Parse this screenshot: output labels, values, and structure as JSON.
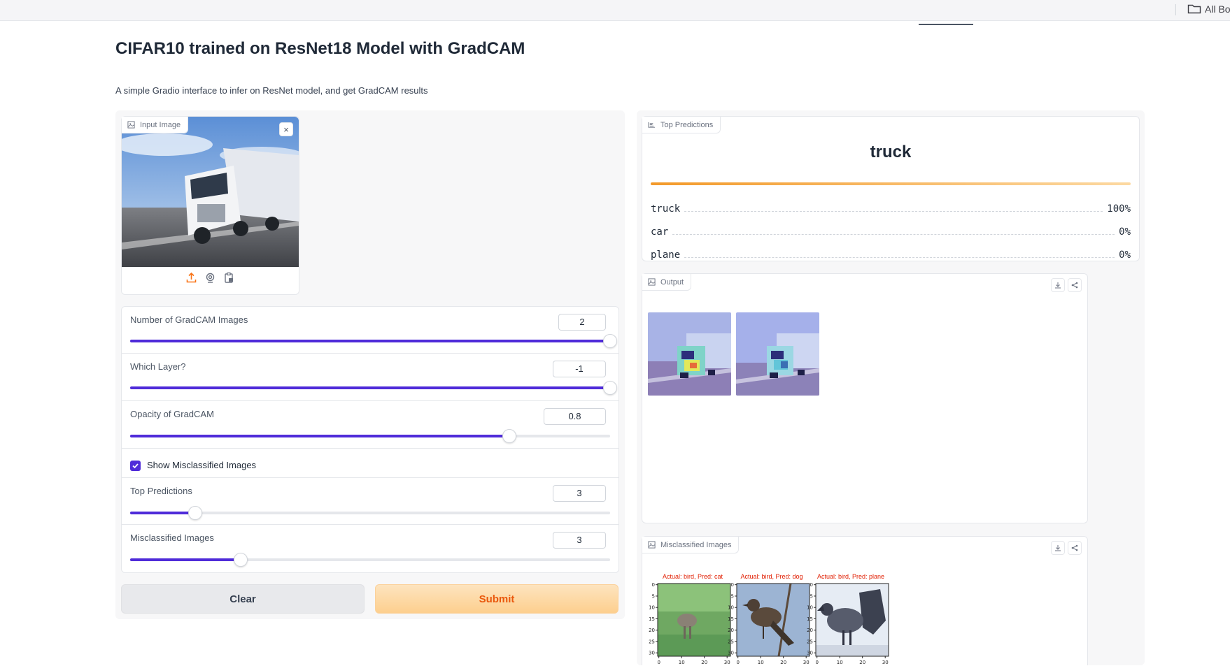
{
  "browser": {
    "bookmark_label": "All Bo"
  },
  "header": {
    "title": "CIFAR10 trained on ResNet18 Model with GradCAM",
    "description": "A simple Gradio interface to infer on ResNet model, and get GradCAM results"
  },
  "input_image": {
    "label": "Input Image",
    "close": "×"
  },
  "controls": {
    "gradcam_images": {
      "label": "Number of GradCAM Images",
      "value": "2",
      "fraction": 1.0
    },
    "layer": {
      "label": "Which Layer?",
      "value": "-1",
      "fraction": 1.0
    },
    "opacity": {
      "label": "Opacity of GradCAM",
      "value": "0.8",
      "fraction": 0.79
    },
    "show_misclassified": {
      "label": "Show Misclassified Images",
      "checked": true
    },
    "top_predictions": {
      "label": "Top Predictions",
      "value": "3",
      "fraction": 0.135
    },
    "misclassified_images": {
      "label": "Misclassified Images",
      "value": "3",
      "fraction": 0.23
    }
  },
  "buttons": {
    "clear": "Clear",
    "submit": "Submit"
  },
  "top_predictions": {
    "label": "Top Predictions",
    "top_class": "truck",
    "items": [
      {
        "class": "truck",
        "confidence": "100%"
      },
      {
        "class": "car",
        "confidence": "0%"
      },
      {
        "class": "plane",
        "confidence": "0%"
      }
    ]
  },
  "output": {
    "label": "Output"
  },
  "misclassified": {
    "label": "Misclassified Images",
    "items": [
      {
        "caption": "Actual: bird, Pred: cat"
      },
      {
        "caption": "Actual: bird, Pred: dog"
      },
      {
        "caption": "Actual: bird, Pred: plane"
      }
    ],
    "y_ticks": [
      "0",
      "5",
      "10",
      "15",
      "20",
      "25",
      "30"
    ],
    "x_ticks": [
      "0",
      "10",
      "20",
      "30"
    ]
  }
}
